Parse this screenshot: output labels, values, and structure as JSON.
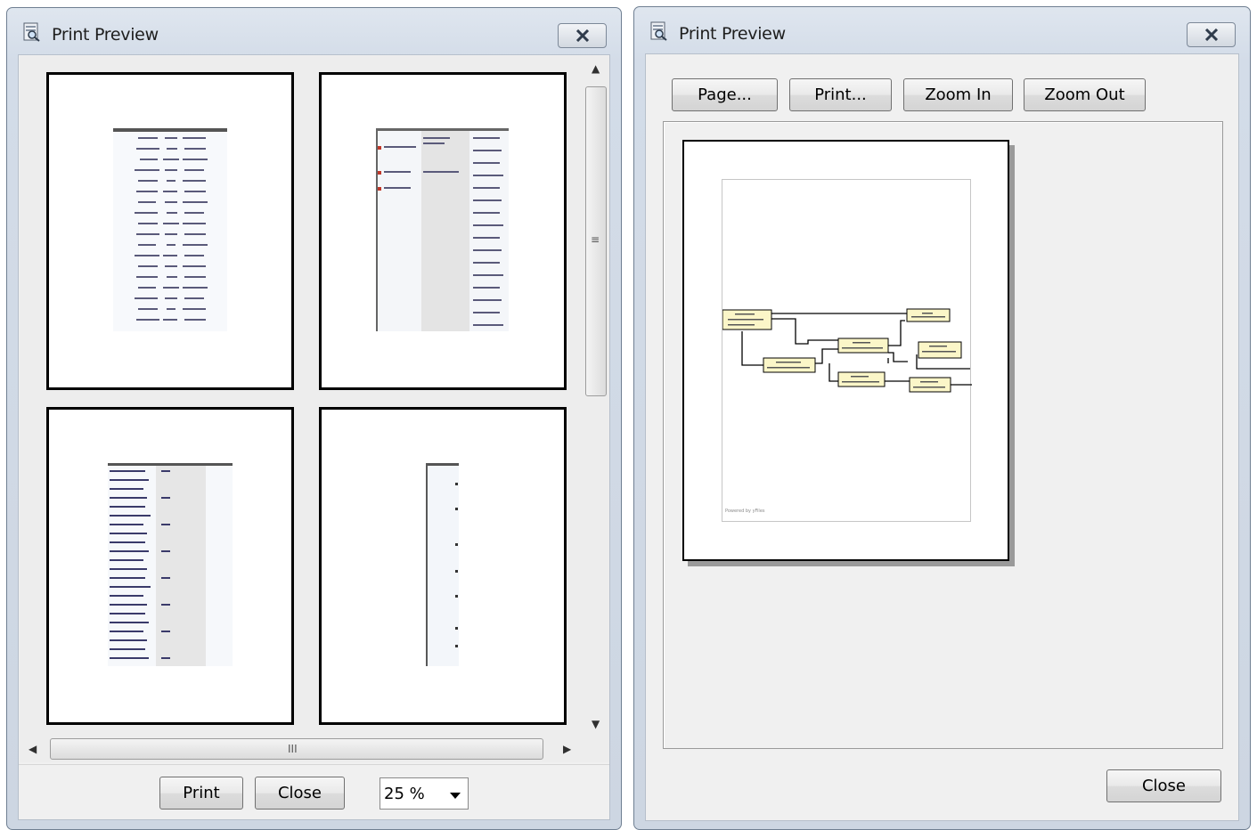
{
  "left_window": {
    "title": "Print Preview",
    "buttons": {
      "print": "Print",
      "close": "Close"
    },
    "zoom": {
      "value": "25 %"
    },
    "scroll_grips": {
      "vertical": "≡",
      "horizontal": "III"
    }
  },
  "right_window": {
    "title": "Print Preview",
    "toolbar": {
      "page": "Page...",
      "print": "Print...",
      "zoom_in": "Zoom In",
      "zoom_out": "Zoom Out"
    },
    "close": "Close",
    "footer_note": "Powered by yFiles"
  },
  "icons": {
    "title": "print-preview-icon",
    "close": "close-icon"
  },
  "colors": {
    "node_fill": "#fbf6c8",
    "node_header": "#f2e7a0",
    "client_bg": "#f0f0f0"
  }
}
